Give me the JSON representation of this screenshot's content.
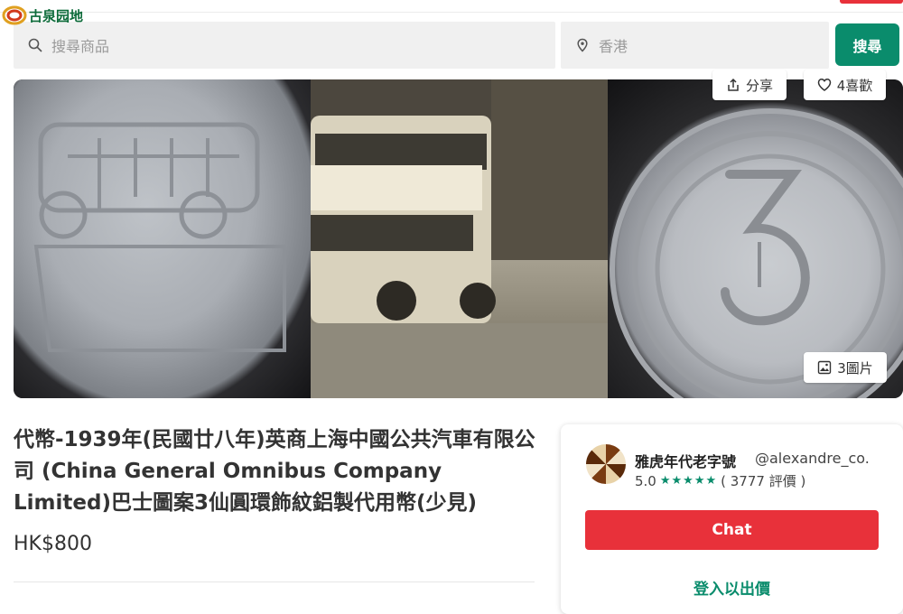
{
  "header": {
    "logo_text": "古泉园地"
  },
  "search": {
    "query_placeholder": "搜尋商品",
    "location_placeholder": "香港",
    "button_label": "搜尋"
  },
  "gallery": {
    "share_label": "分享",
    "like_label": "4喜歡",
    "photos_label": "3圖片"
  },
  "listing": {
    "title": "代幣-1939年(民國廿八年)英商上海中國公共汽車有限公司 (China General Omnibus Company Limited)巴士圖案3仙圓環飾紋鋁製代用幣(少見)",
    "price": "HK$800"
  },
  "seller": {
    "name": "雅虎年代老字號",
    "handle": "@alexandre_co.",
    "rating": "5.0",
    "stars": "★★★★★",
    "reviews": "( 3777 評價 )",
    "chat_label": "Chat",
    "offer_label": "登入以出價"
  },
  "colors": {
    "accent_green": "#0a8c6c",
    "accent_red": "#e8313a"
  }
}
